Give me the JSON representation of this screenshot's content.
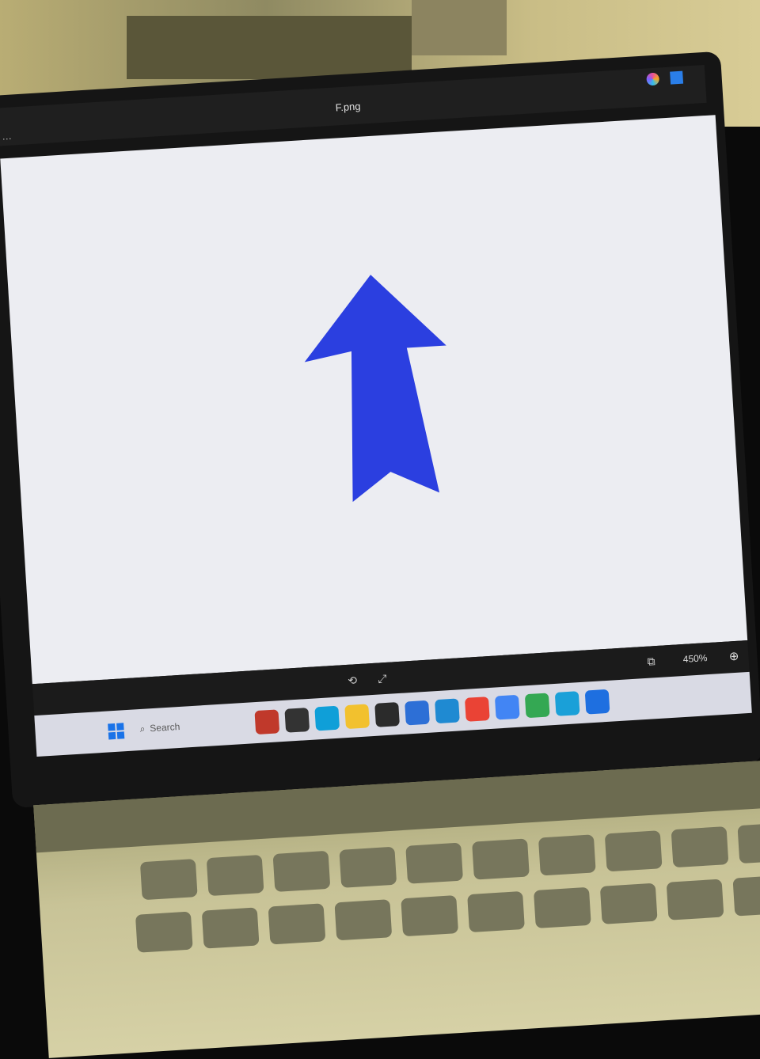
{
  "window": {
    "title": "F.png",
    "menu_dots": "···"
  },
  "image": {
    "arrow_color": "#2b3fe0",
    "arrow_direction": "up",
    "background_color": "#ecedf2"
  },
  "viewer_bar": {
    "zoom_level": "450%",
    "zoom_in_icon": "zoom-in-icon"
  },
  "taskbar": {
    "search_placeholder": "Search",
    "start_icon": "windows-start-icon",
    "apps": [
      {
        "name": "app-1",
        "icon": "app-colorful-icon",
        "color": "#c0392b"
      },
      {
        "name": "app-2",
        "icon": "terminal-icon",
        "color": "#333333"
      },
      {
        "name": "app-3",
        "icon": "edge-icon",
        "color": "#0f9fd8"
      },
      {
        "name": "app-4",
        "icon": "file-explorer-icon",
        "color": "#f2c12e"
      },
      {
        "name": "app-5",
        "icon": "console-icon",
        "color": "#2b2b2b"
      },
      {
        "name": "app-6",
        "icon": "app-blue-icon",
        "color": "#2d6fd6"
      },
      {
        "name": "app-7",
        "icon": "vscode-icon",
        "color": "#1f8ad2"
      },
      {
        "name": "app-8",
        "icon": "chrome-icon",
        "color": "#ea4335"
      },
      {
        "name": "app-9",
        "icon": "chrome-variant-icon",
        "color": "#4285f4"
      },
      {
        "name": "app-10",
        "icon": "chrome-alt-icon",
        "color": "#34a853"
      },
      {
        "name": "app-11",
        "icon": "edge-alt-icon",
        "color": "#1aa0d8"
      },
      {
        "name": "app-12",
        "icon": "photos-icon",
        "color": "#1e6fe0"
      }
    ]
  }
}
